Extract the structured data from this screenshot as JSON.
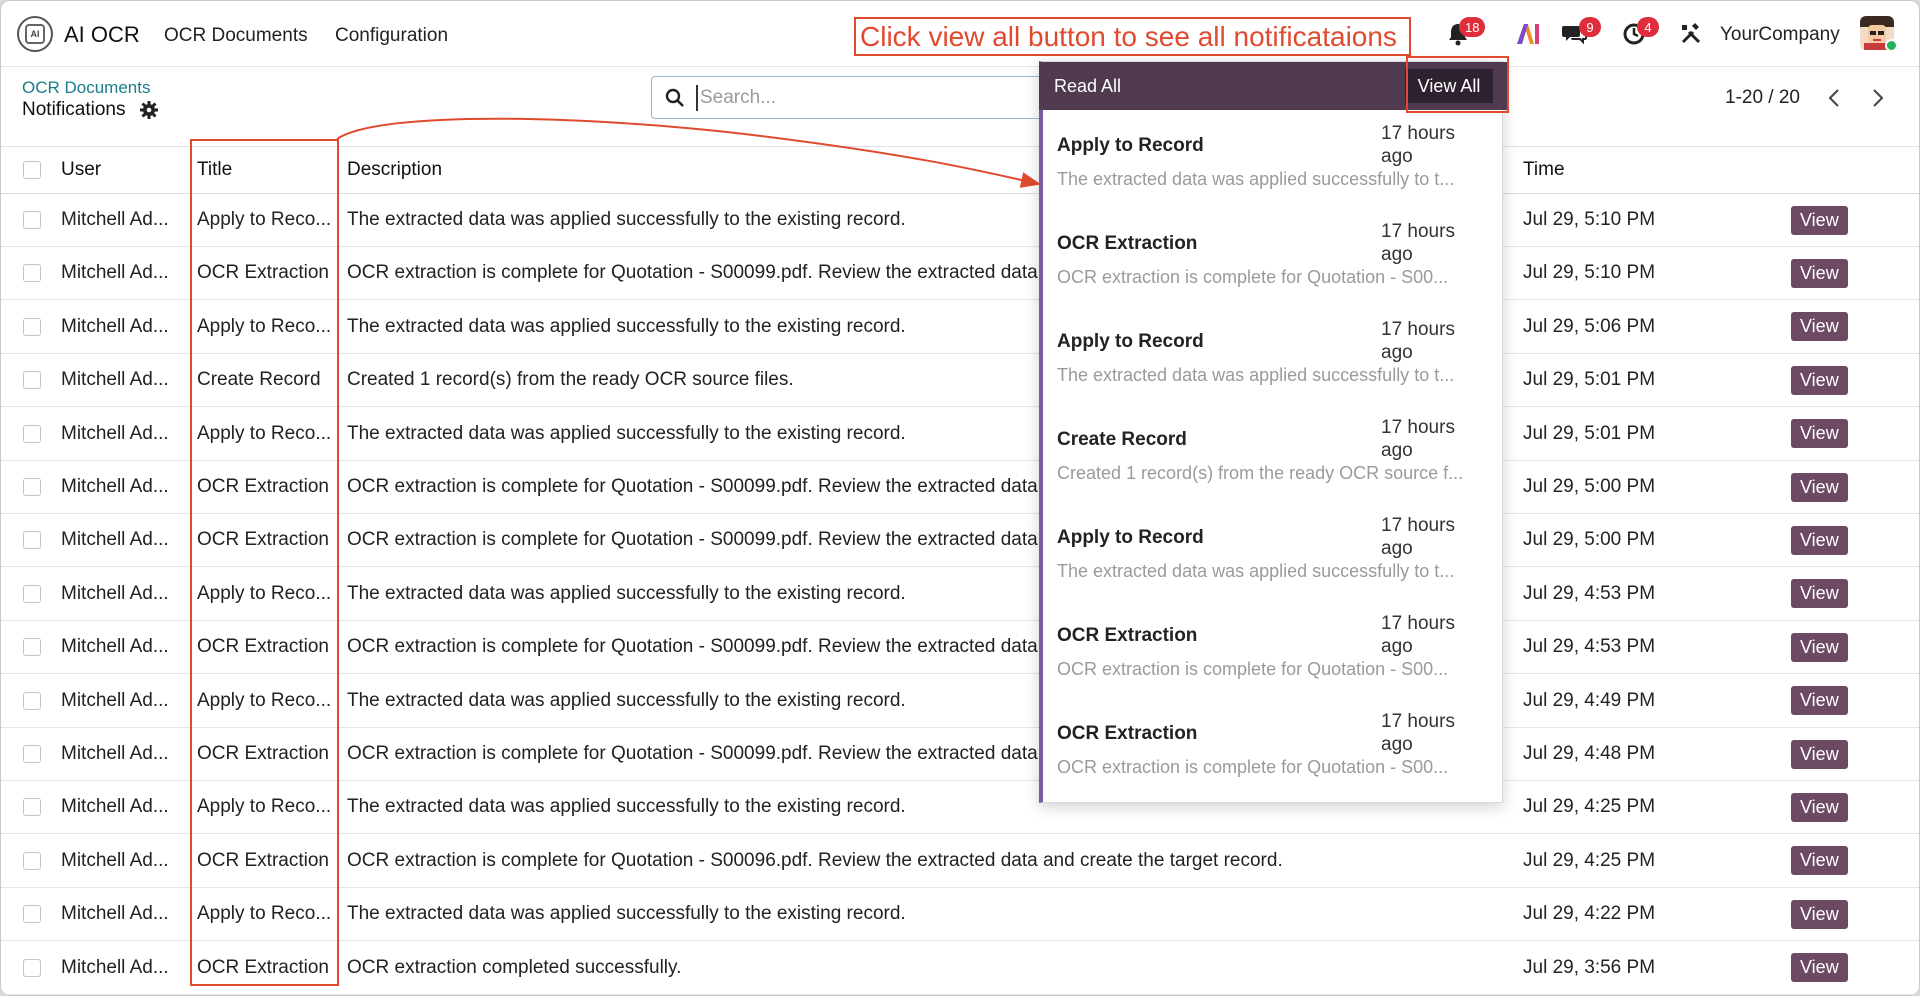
{
  "navbar": {
    "app_name": "AI OCR",
    "menus": [
      "OCR Documents",
      "Configuration"
    ],
    "annotation": "Click view all button to see all notificataions",
    "badges": {
      "activity": "18",
      "messages": "9",
      "clock": "4"
    },
    "company": "YourCompany"
  },
  "control_panel": {
    "breadcrumb": "OCR Documents",
    "title": "Notifications",
    "search_placeholder": "Search...",
    "pager": "1-20 / 20"
  },
  "list": {
    "headers": {
      "user": "User",
      "title": "Title",
      "description": "Description",
      "time": "Time"
    },
    "view_label": "View",
    "rows": [
      {
        "user": "Mitchell Ad...",
        "title": "Apply to Reco...",
        "description": "The extracted data was applied successfully to the existing record.",
        "time": "Jul 29, 5:10 PM"
      },
      {
        "user": "Mitchell Ad...",
        "title": "OCR Extraction",
        "description": "OCR extraction is complete for Quotation - S00099.pdf. Review the extracted data and create the target record.",
        "time": "Jul 29, 5:10 PM"
      },
      {
        "user": "Mitchell Ad...",
        "title": "Apply to Reco...",
        "description": "The extracted data was applied successfully to the existing record.",
        "time": "Jul 29, 5:06 PM"
      },
      {
        "user": "Mitchell Ad...",
        "title": "Create Record",
        "description": "Created 1 record(s) from the ready OCR source files.",
        "time": "Jul 29, 5:01 PM"
      },
      {
        "user": "Mitchell Ad...",
        "title": "Apply to Reco...",
        "description": "The extracted data was applied successfully to the existing record.",
        "time": "Jul 29, 5:01 PM"
      },
      {
        "user": "Mitchell Ad...",
        "title": "OCR Extraction",
        "description": "OCR extraction is complete for Quotation - S00099.pdf. Review the extracted data and create the target record.",
        "time": "Jul 29, 5:00 PM"
      },
      {
        "user": "Mitchell Ad...",
        "title": "OCR Extraction",
        "description": "OCR extraction is complete for Quotation - S00099.pdf. Review the extracted data and create the target record.",
        "time": "Jul 29, 5:00 PM"
      },
      {
        "user": "Mitchell Ad...",
        "title": "Apply to Reco...",
        "description": "The extracted data was applied successfully to the existing record.",
        "time": "Jul 29, 4:53 PM"
      },
      {
        "user": "Mitchell Ad...",
        "title": "OCR Extraction",
        "description": "OCR extraction is complete for Quotation - S00099.pdf. Review the extracted data and create the target record.",
        "time": "Jul 29, 4:53 PM"
      },
      {
        "user": "Mitchell Ad...",
        "title": "Apply to Reco...",
        "description": "The extracted data was applied successfully to the existing record.",
        "time": "Jul 29, 4:49 PM"
      },
      {
        "user": "Mitchell Ad...",
        "title": "OCR Extraction",
        "description": "OCR extraction is complete for Quotation - S00099.pdf. Review the extracted data and create the target record.",
        "time": "Jul 29, 4:48 PM"
      },
      {
        "user": "Mitchell Ad...",
        "title": "Apply to Reco...",
        "description": "The extracted data was applied successfully to the existing record.",
        "time": "Jul 29, 4:25 PM"
      },
      {
        "user": "Mitchell Ad...",
        "title": "OCR Extraction",
        "description": "OCR extraction is complete for Quotation - S00096.pdf. Review the extracted data and create the target record.",
        "time": "Jul 29, 4:25 PM"
      },
      {
        "user": "Mitchell Ad...",
        "title": "Apply to Reco...",
        "description": "The extracted data was applied successfully to the existing record.",
        "time": "Jul 29, 4:22 PM"
      },
      {
        "user": "Mitchell Ad...",
        "title": "OCR Extraction",
        "description": "OCR extraction completed successfully.",
        "time": "Jul 29, 3:56 PM"
      }
    ]
  },
  "notifications": {
    "read_all": "Read All",
    "view_all": "View All",
    "items": [
      {
        "title": "Apply to Record",
        "time": "17 hours ago",
        "description": "The extracted data was applied successfully to t..."
      },
      {
        "title": "OCR Extraction",
        "time": "17 hours ago",
        "description": "OCR extraction is complete for Quotation - S00..."
      },
      {
        "title": "Apply to Record",
        "time": "17 hours ago",
        "description": "The extracted data was applied successfully to t..."
      },
      {
        "title": "Create Record",
        "time": "17 hours ago",
        "description": "Created 1 record(s) from the ready OCR source f..."
      },
      {
        "title": "Apply to Record",
        "time": "17 hours ago",
        "description": "The extracted data was applied successfully to t..."
      },
      {
        "title": "OCR Extraction",
        "time": "17 hours ago",
        "description": "OCR extraction is complete for Quotation - S00..."
      },
      {
        "title": "OCR Extraction",
        "time": "17 hours ago",
        "description": "OCR extraction is complete for Quotation - S00..."
      }
    ]
  },
  "colors": {
    "primary": "#6c4a63",
    "annotation": "#e04a2e",
    "link": "#1a7c8c",
    "badge": "#e02d3c"
  }
}
